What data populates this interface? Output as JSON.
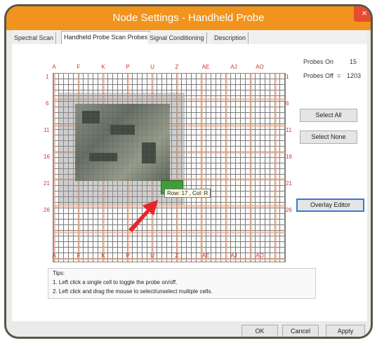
{
  "window": {
    "title": "Node Settings - Handheld Probe",
    "close_glyph": "×"
  },
  "tabs": [
    {
      "label": "Spectral Scan",
      "active": false
    },
    {
      "label": "Handheld Probe Scan Probes",
      "active": true
    },
    {
      "label": "Signal Conditioning",
      "active": false
    },
    {
      "label": "Description",
      "active": false
    }
  ],
  "grid": {
    "column_labels": [
      "A",
      "F",
      "K",
      "P",
      "U",
      "Z",
      "AE",
      "AJ",
      "AO"
    ],
    "row_labels": [
      "1",
      "6",
      "11",
      "16",
      "21",
      "26"
    ],
    "tooltip": "Row: 17 , Col: R"
  },
  "probes": {
    "on_label": "Probes On",
    "on_value": "15",
    "off_label": "Probes Off",
    "off_separator": "=",
    "off_value": "1203"
  },
  "buttons": {
    "select_all": "Select All",
    "select_none": "Select None",
    "overlay_editor": "Overlay Editor"
  },
  "tips": {
    "heading": "Tips:",
    "lines": [
      "1. Left click a single cell to toggle the probe on/off.",
      "2. Left click and drag the mouse to select/unselect multiple cells."
    ]
  },
  "footer": {
    "ok": "OK",
    "cancel": "Cancel",
    "apply": "Apply"
  },
  "colors": {
    "titlebar": "#f0941d",
    "close": "#e64d2e",
    "annotation_arrow": "#e8262a",
    "grid_major": "#eea078"
  }
}
